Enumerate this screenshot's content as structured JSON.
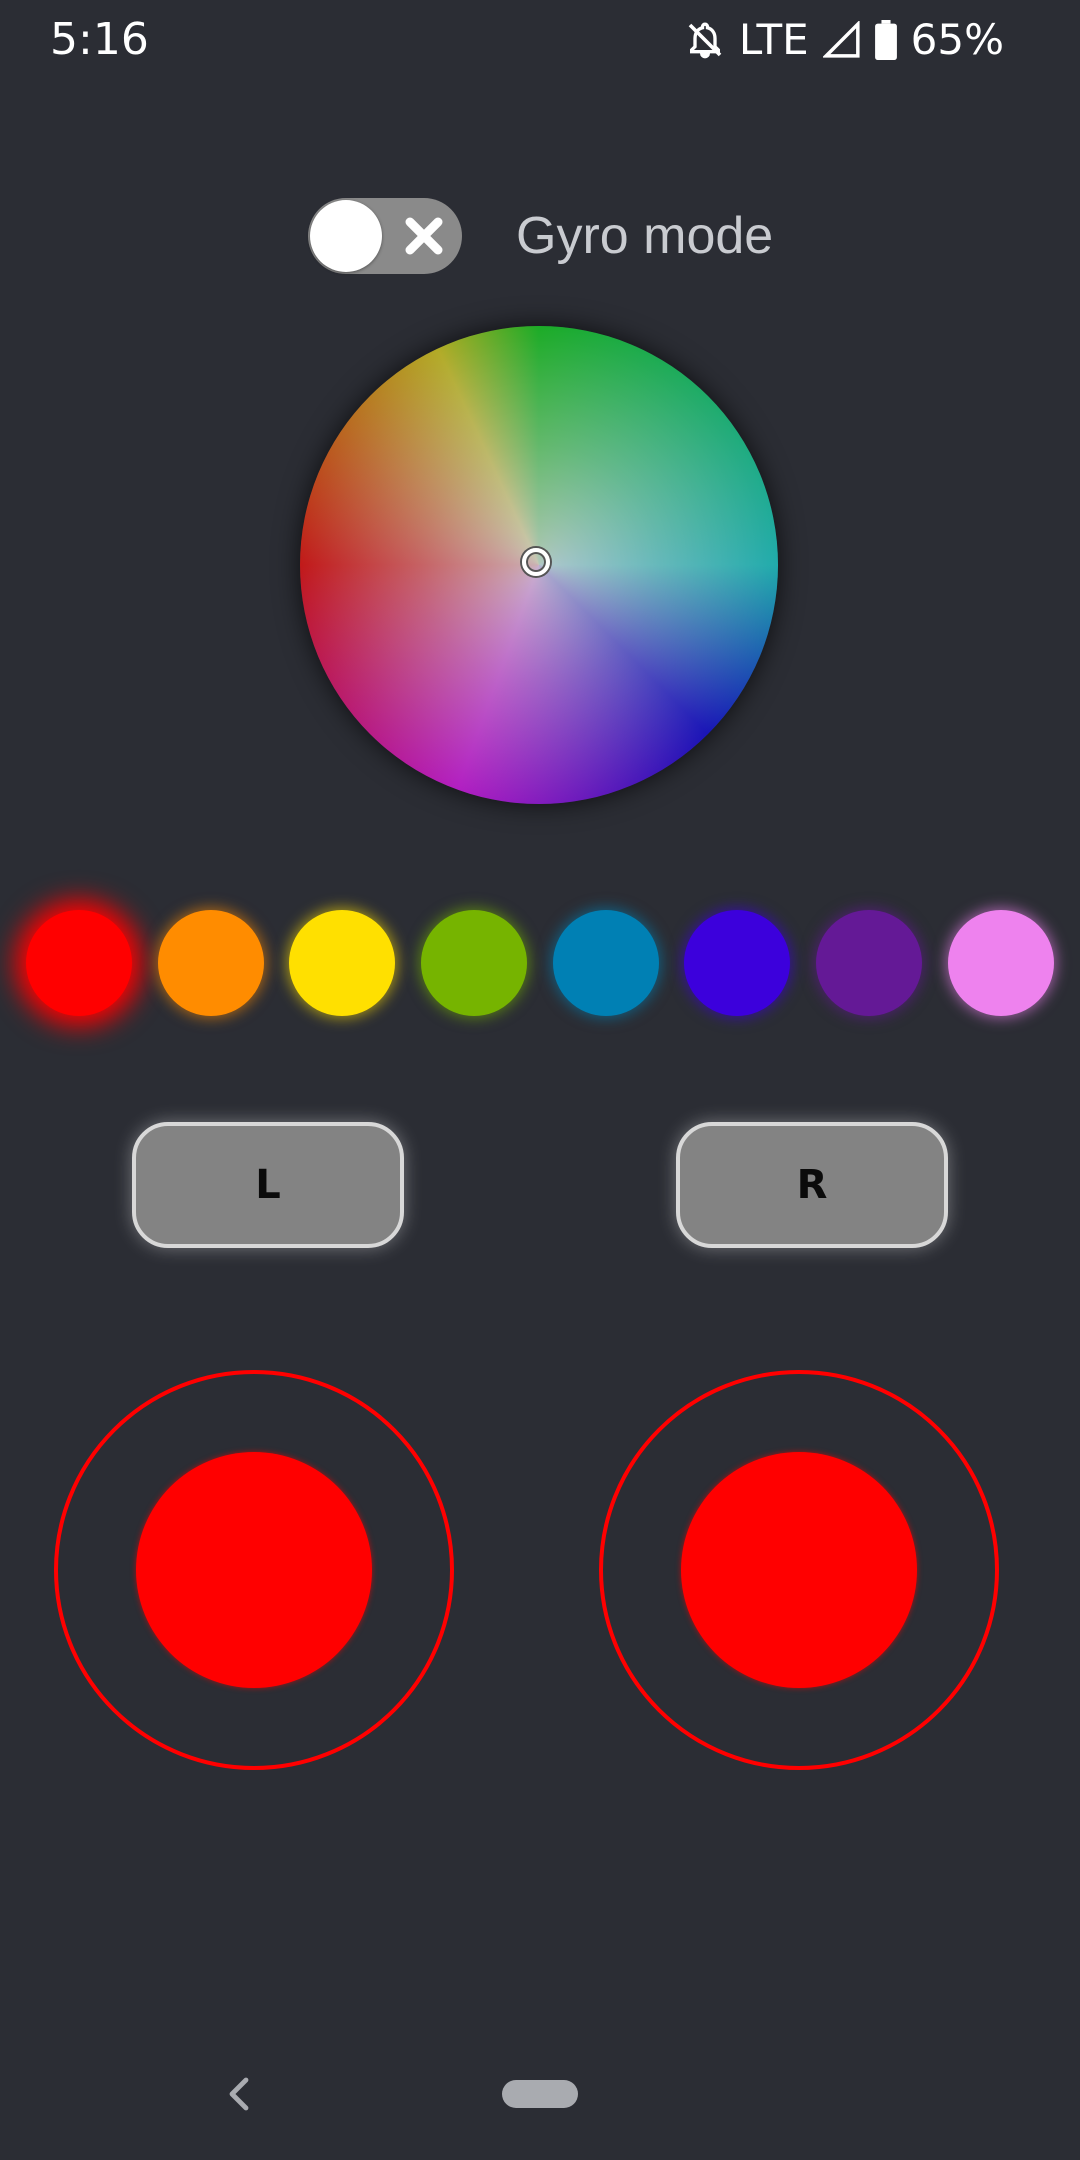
{
  "status_bar": {
    "time": "5:16",
    "network": "LTE",
    "battery": "65%",
    "icons": [
      "notifications-off-icon",
      "signal-icon",
      "battery-icon"
    ]
  },
  "gyro": {
    "label": "Gyro mode",
    "enabled": false
  },
  "color_wheel": {
    "selected_color": "#c8c8cc"
  },
  "swatches": [
    {
      "name": "red",
      "color": "#ff0000",
      "selected": true
    },
    {
      "name": "orange",
      "color": "#ff8c00",
      "selected": false
    },
    {
      "name": "yellow",
      "color": "#ffe000",
      "selected": false
    },
    {
      "name": "green",
      "color": "#76b400",
      "selected": false
    },
    {
      "name": "blue",
      "color": "#0080b4",
      "selected": false
    },
    {
      "name": "indigo",
      "color": "#3c00dc",
      "selected": false
    },
    {
      "name": "purple",
      "color": "#641996",
      "selected": false
    },
    {
      "name": "violet",
      "color": "#ee82ee",
      "selected": false
    }
  ],
  "buttons": {
    "left_label": "L",
    "right_label": "R"
  },
  "joysticks": {
    "color": "#ff0000"
  },
  "nav": {
    "icons": [
      "back-icon",
      "home-pill"
    ]
  }
}
